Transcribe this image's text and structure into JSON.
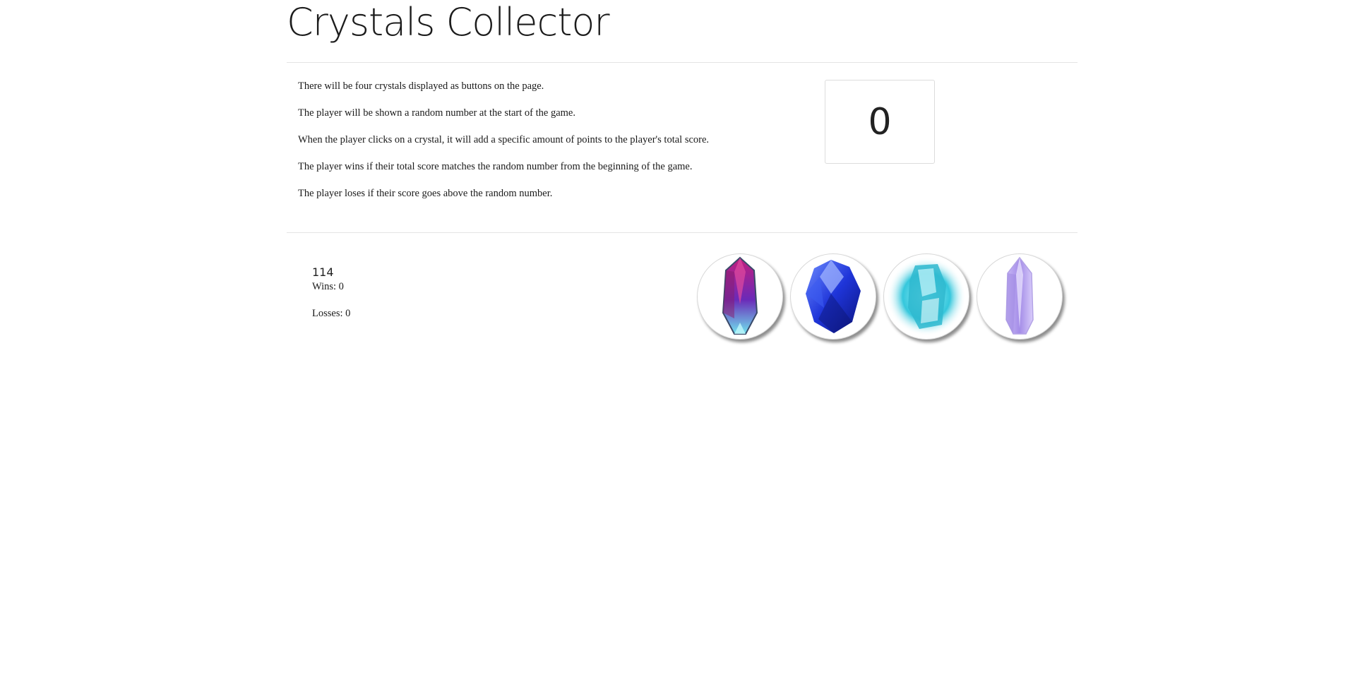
{
  "header": {
    "title": "Crystals Collector"
  },
  "instructions": [
    "There will be four crystals displayed as buttons on the page.",
    "The player will be shown a random number at the start of the game.",
    "When the player clicks on a crystal, it will add a specific amount of points to the player's total score.",
    "The player wins if their total score matches the random number from the beginning of the game.",
    "The player loses if their score goes above the random number."
  ],
  "score": {
    "total": "0"
  },
  "stats": {
    "target_number": "114",
    "wins_label": "Wins: 0",
    "losses_label": "Losses: 0"
  },
  "crystals": [
    {
      "icon": "pink-crystal-icon",
      "color": "#b0237a"
    },
    {
      "icon": "blue-crystal-icon",
      "color": "#2a3fd8"
    },
    {
      "icon": "cyan-crystal-icon",
      "color": "#2bc0d6"
    },
    {
      "icon": "lavender-crystal-icon",
      "color": "#b9a4ee"
    }
  ]
}
